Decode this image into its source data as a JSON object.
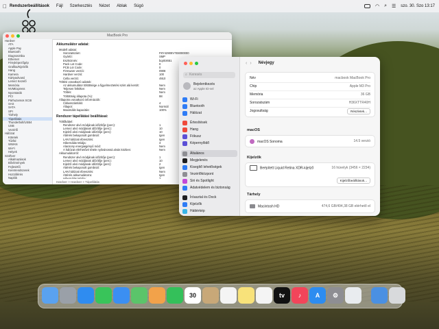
{
  "menubar": {
    "app": "Rendszerbeállítások",
    "items": [
      "Fájl",
      "Szerkesztés",
      "Nézet",
      "Ablak",
      "Súgó"
    ],
    "datetime": "szo. 30.  Szo  13:17"
  },
  "sysinfo": {
    "title": "MacBook Pro",
    "sidebar": [
      "Hardver",
      "ATA",
      "Apple Pay",
      "Bluetooth",
      "Diagnosztika",
      "Ethernet",
      "Fényképezőgép",
      "Grafika/Kijelzők",
      "Hang",
      "Kamera",
      "Kártyaolvasó",
      "Lemez Kezelő",
      "Memória",
      "NVMExpress",
      "Nyomtatók",
      "PCI",
      "Párhuzamos SCSI",
      "SAS",
      "SATA",
      "SPI",
      "Tárhely",
      "Tápellátás",
      "Thunderbolt/USB4",
      "USB",
      "Vezérlő",
      "Hálózat",
      "Kötetek",
      "Tűzfal",
      "WWAN",
      "Wi-Fi",
      "Helyek",
      "Szoftver",
      "Alkalmazások",
      "Bővítmények",
      "Fejlesztői",
      "Keretrendszerek",
      "Hozzáférés",
      "Naplók"
    ],
    "sidebar_selected": 21,
    "section1": "Akkumulátor adatai:",
    "sub1": "Modell adatai:",
    "rows1": [
      [
        "Sorozatszám:",
        "F8Y42908V7E8000000"
      ],
      [
        "Gyártó:",
        "SMP"
      ],
      [
        "Eszköznév:",
        "bq40z651"
      ],
      [
        "Pack Lot Code:",
        "0"
      ],
      [
        "PCB Lot Code:",
        "0"
      ],
      [
        "Firmware verzió:",
        "0908"
      ],
      [
        "Hardver verzió:",
        "100"
      ],
      [
        "Cella verzió:",
        "4910"
      ]
    ],
    "sub2": "Töltési vonatkozó adatok:",
    "rows2": [
      [
        "Az akkumulátor töltöttsége a figyelmeztetési szint alá került:",
        "Nem"
      ],
      [
        "Teljesen feltöltve:",
        "Nem"
      ],
      [
        "Töltés:",
        "Nem"
      ],
      [
        "Töltöttség állapota (%):",
        "98"
      ]
    ],
    "sub3": "Állapotra vonatkozó információk:",
    "rows3": [
      [
        "Ciklusszámláló:",
        "4"
      ],
      [
        "Állapot:",
        "Normál"
      ],
      [
        "Maximális kapacitás:",
        "100%"
      ]
    ],
    "section2": "Rendszer tápellátási beállításai:",
    "sub4": "Töltőkábel:",
    "rows4": [
      [
        "Rendszer alvó módjának időzítője (perc):",
        "1"
      ],
      [
        "Lemez alvó módjának időzítője (perc):",
        "10"
      ],
      [
        "Kijelző alvó módjának időzítője (perc):",
        "10"
      ],
      [
        "Áttérés bekapcsolt gombnál:",
        "Igen"
      ],
      [
        "LAN hálózati ébresztés:",
        "Igen"
      ],
      [
        "Hibernálás Módja:",
        "3"
      ],
      [
        "Alacsony energiaigényű mód:",
        "Nem"
      ],
      [
        "A hálózat elérhetővé tétele nyilvánossá alvás közben:",
        "Nem"
      ]
    ],
    "sub5": "Akkumulátorról:",
    "rows5": [
      [
        "Rendszer alvó módjának időzítője (perc):",
        "1"
      ],
      [
        "Lemez alvó módjának időzítője (perc):",
        "10"
      ],
      [
        "Kijelző alvó módjának időzítője (perc):",
        "2"
      ],
      [
        "Áttérés bekapcsolt gombnál:",
        "Igen"
      ],
      [
        "LAN hálózati ébresztés:",
        "Nem"
      ],
      [
        "Áttérés akkumulátorra:",
        "Igen"
      ],
      [
        "Hibernálás Módja:",
        "3"
      ],
      [
        "Alacsony energiaigényű mód:",
        "Nem"
      ],
      [
        "A hálózat elérhetővé tétele nyilvánossá alvás közben:",
        "Nem"
      ]
    ],
    "breadcrumb": "Hardver > Hardver > Tápellátás"
  },
  "settings": {
    "search_placeholder": "Keresés",
    "account_name": "Bejelentkezés",
    "account_sub": "az Apple ID-vel",
    "items": [
      {
        "label": "Wi-Fi",
        "color": "#2f7cf6"
      },
      {
        "label": "Bluetooth",
        "color": "#2f7cf6"
      },
      {
        "label": "Hálózat",
        "color": "#2f7cf6"
      },
      {
        "label": "Értesítések",
        "color": "#ef4a3c"
      },
      {
        "label": "Hang",
        "color": "#ef4a3c"
      },
      {
        "label": "Fókusz",
        "color": "#5b4fd6"
      },
      {
        "label": "Képernyőidő",
        "color": "#5b4fd6"
      },
      {
        "label": "Általános",
        "color": "#8e8e93"
      },
      {
        "label": "Megjelenés",
        "color": "#1d1d1f"
      },
      {
        "label": "Kisegítő lehetőségek",
        "color": "#2f7cf6"
      },
      {
        "label": "Vezérlőközpont",
        "color": "#8e8e93"
      },
      {
        "label": "Siri és Spotlight",
        "color": "#c348d8"
      },
      {
        "label": "Adatvédelem és biztonság",
        "color": "#2f7cf6"
      },
      {
        "label": "Íróasztal és Dock",
        "color": "#1d1d1f"
      },
      {
        "label": "Kijelzők",
        "color": "#2f7cf6"
      },
      {
        "label": "Háttérkép",
        "color": "#39b6e8"
      }
    ],
    "selected": 7,
    "page_title": "Névjegy",
    "rows": [
      {
        "label": "Név",
        "value": "macbook MacBook Pro"
      },
      {
        "label": "Chip",
        "value": "Apple M3 Pro"
      },
      {
        "label": "Memória",
        "value": "36 GB"
      },
      {
        "label": "Sorozatszám",
        "value": "H36XTTR40H"
      },
      {
        "label": "Jogosultság",
        "value": "Részletek..."
      }
    ],
    "macos_heading": "macOS",
    "macos_name": "macOS Sonoma",
    "macos_version": "14.5 verzió",
    "displays_heading": "Kijelzők",
    "display_name": "Beépített Liquid Retina XDR-kijelző",
    "display_res": "16 hüvelyk (3456 × 2234)",
    "display_button": "Kijelzőbeállítások...",
    "storage_heading": "Tárhely",
    "disk_name": "Macintosh HD",
    "disk_info": "474,6 GB/494,38 GB elérhető el"
  },
  "dock": [
    {
      "name": "finder-icon",
      "color": "#5aa2ef",
      "glyph": ""
    },
    {
      "name": "launchpad-icon",
      "color": "#9aa0a8",
      "glyph": ""
    },
    {
      "name": "safari-icon",
      "color": "#2f8cf0",
      "glyph": ""
    },
    {
      "name": "messages-icon",
      "color": "#39c45a",
      "glyph": ""
    },
    {
      "name": "mail-icon",
      "color": "#3b8ff2",
      "glyph": ""
    },
    {
      "name": "maps-icon",
      "color": "#5bc46a",
      "glyph": ""
    },
    {
      "name": "photos-icon",
      "color": "#f2a24a",
      "glyph": ""
    },
    {
      "name": "facetime-icon",
      "color": "#34c05a",
      "glyph": ""
    },
    {
      "name": "calendar-icon",
      "color": "#ffffff",
      "glyph": "30"
    },
    {
      "name": "contacts-icon",
      "color": "#c8a878",
      "glyph": ""
    },
    {
      "name": "reminders-icon",
      "color": "#f4f4f4",
      "glyph": ""
    },
    {
      "name": "notes-icon",
      "color": "#f8e27a",
      "glyph": ""
    },
    {
      "name": "freeform-icon",
      "color": "#f4f4f4",
      "glyph": ""
    },
    {
      "name": "appletv-icon",
      "color": "#111111",
      "glyph": "tv"
    },
    {
      "name": "music-icon",
      "color": "#f2455a",
      "glyph": "♪"
    },
    {
      "name": "appstore-icon",
      "color": "#2d8cf0",
      "glyph": "A"
    },
    {
      "name": "system-settings-icon",
      "color": "#8e8e93",
      "glyph": "⚙"
    },
    {
      "name": "preview-icon",
      "color": "#e9ecef",
      "glyph": ""
    },
    {
      "name": "downloads-icon",
      "color": "#4a90e2",
      "glyph": ""
    },
    {
      "name": "trash-icon",
      "color": "#d8dadc",
      "glyph": ""
    }
  ]
}
